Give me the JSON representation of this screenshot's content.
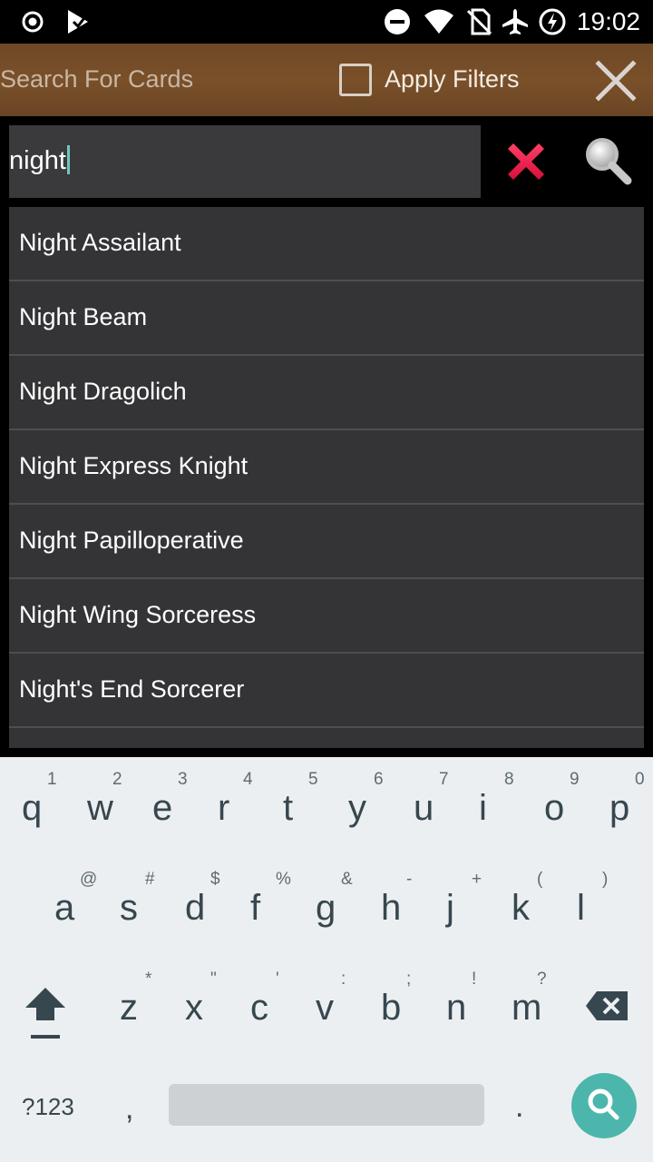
{
  "status_bar": {
    "time": "19:02",
    "icons": [
      "record-icon",
      "play-store-icon",
      "do-not-disturb-icon",
      "wifi-icon",
      "no-sim-icon",
      "airplane-icon",
      "battery-charging-icon"
    ]
  },
  "app_bar": {
    "title": "Search For Cards",
    "filter_label": "Apply Filters",
    "filter_checked": false,
    "close_icon": "close-icon"
  },
  "search": {
    "value": "night",
    "clear_icon": "clear-x-icon",
    "search_icon": "magnifier-icon"
  },
  "suggestions": [
    "Night Assailant",
    "Night Beam",
    "Night Dragolich",
    "Night Express Knight",
    "Night Papilloperative",
    "Night Wing Sorceress",
    "Night's End Sorcerer"
  ],
  "keyboard": {
    "row1": [
      {
        "key": "q",
        "hint": "1"
      },
      {
        "key": "w",
        "hint": "2"
      },
      {
        "key": "e",
        "hint": "3"
      },
      {
        "key": "r",
        "hint": "4"
      },
      {
        "key": "t",
        "hint": "5"
      },
      {
        "key": "y",
        "hint": "6"
      },
      {
        "key": "u",
        "hint": "7"
      },
      {
        "key": "i",
        "hint": "8"
      },
      {
        "key": "o",
        "hint": "9"
      },
      {
        "key": "p",
        "hint": "0"
      }
    ],
    "row2": [
      {
        "key": "a",
        "hint": "@"
      },
      {
        "key": "s",
        "hint": "#"
      },
      {
        "key": "d",
        "hint": "$"
      },
      {
        "key": "f",
        "hint": "%"
      },
      {
        "key": "g",
        "hint": "&"
      },
      {
        "key": "h",
        "hint": "-"
      },
      {
        "key": "j",
        "hint": "+"
      },
      {
        "key": "k",
        "hint": "("
      },
      {
        "key": "l",
        "hint": ")"
      }
    ],
    "row3": [
      {
        "key": "z",
        "hint": "*"
      },
      {
        "key": "x",
        "hint": "\""
      },
      {
        "key": "c",
        "hint": "'"
      },
      {
        "key": "v",
        "hint": ":"
      },
      {
        "key": "b",
        "hint": ";"
      },
      {
        "key": "n",
        "hint": "!"
      },
      {
        "key": "m",
        "hint": "?"
      }
    ],
    "symbols_label": "?123",
    "comma": ",",
    "period": ".",
    "enter_icon": "search-icon",
    "accent": "#4db6ac"
  }
}
